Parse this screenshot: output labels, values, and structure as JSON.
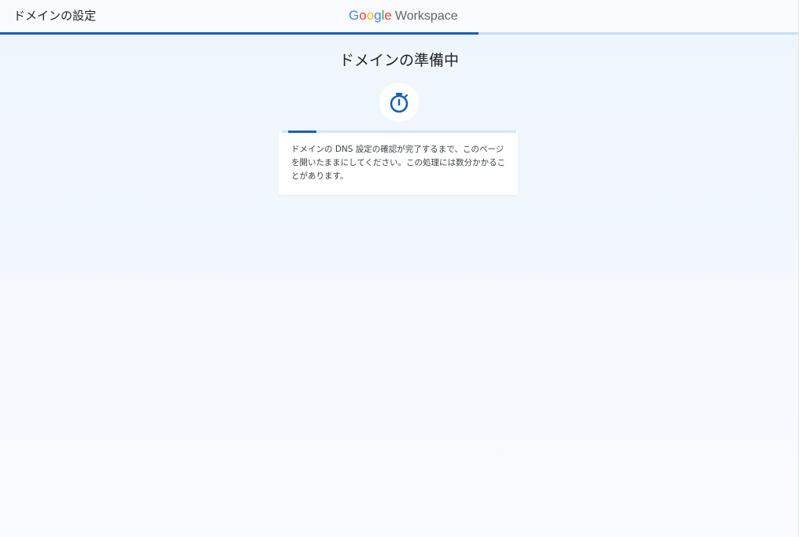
{
  "header": {
    "page_heading": "ドメインの設定",
    "brand": {
      "letters": [
        {
          "char": "G",
          "color": "#4285F4"
        },
        {
          "char": "o",
          "color": "#EA4335"
        },
        {
          "char": "o",
          "color": "#FBBC05"
        },
        {
          "char": "g",
          "color": "#4285F4"
        },
        {
          "char": "l",
          "color": "#34A853"
        },
        {
          "char": "e",
          "color": "#EA4335"
        }
      ],
      "product": "Workspace"
    },
    "step_progress": 0.6
  },
  "main": {
    "title": "ドメインの準備中",
    "status_icon": "stopwatch-icon",
    "card": {
      "progress": 0.12,
      "message": "ドメインの DNS 設定の確認が完了するまで、このページを開いたままにしてください。この処理には数分かかることがあります。"
    }
  },
  "colors": {
    "accent": "#1a5fb4",
    "track": "#c6e0f7",
    "background": "#eef6fc"
  }
}
